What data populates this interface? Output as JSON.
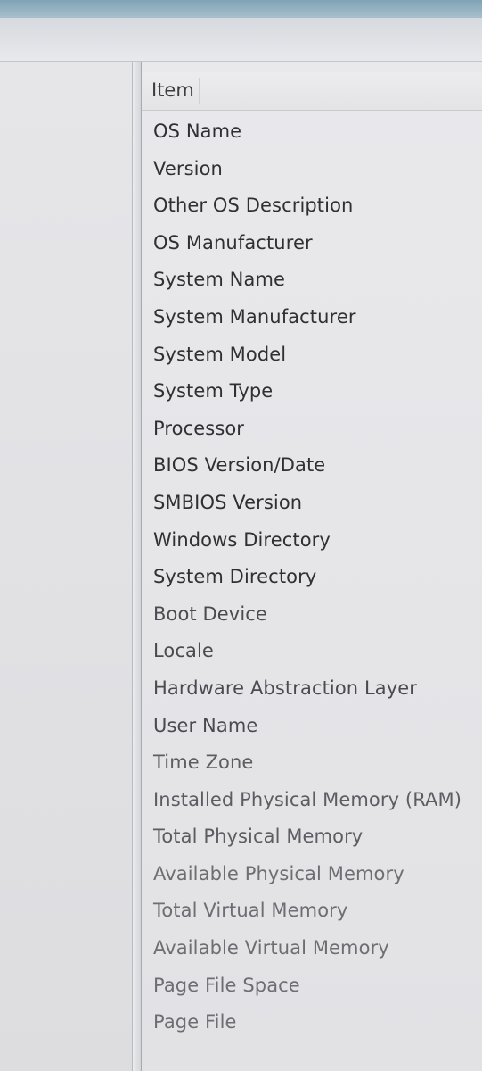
{
  "window": {
    "column_header": "Item"
  },
  "items": [
    {
      "label": "OS Name"
    },
    {
      "label": "Version"
    },
    {
      "label": "Other OS Description"
    },
    {
      "label": "OS Manufacturer"
    },
    {
      "label": "System Name"
    },
    {
      "label": "System Manufacturer"
    },
    {
      "label": "System Model"
    },
    {
      "label": "System Type"
    },
    {
      "label": "Processor"
    },
    {
      "label": "BIOS Version/Date"
    },
    {
      "label": "SMBIOS Version"
    },
    {
      "label": "Windows Directory"
    },
    {
      "label": "System Directory"
    },
    {
      "label": "Boot Device"
    },
    {
      "label": "Locale"
    },
    {
      "label": "Hardware Abstraction Layer"
    },
    {
      "label": "User Name"
    },
    {
      "label": "Time Zone"
    },
    {
      "label": "Installed Physical Memory (RAM)"
    },
    {
      "label": "Total Physical Memory"
    },
    {
      "label": "Available Physical Memory"
    },
    {
      "label": "Total Virtual Memory"
    },
    {
      "label": "Available Virtual Memory"
    },
    {
      "label": "Page File Space"
    },
    {
      "label": "Page File"
    }
  ]
}
